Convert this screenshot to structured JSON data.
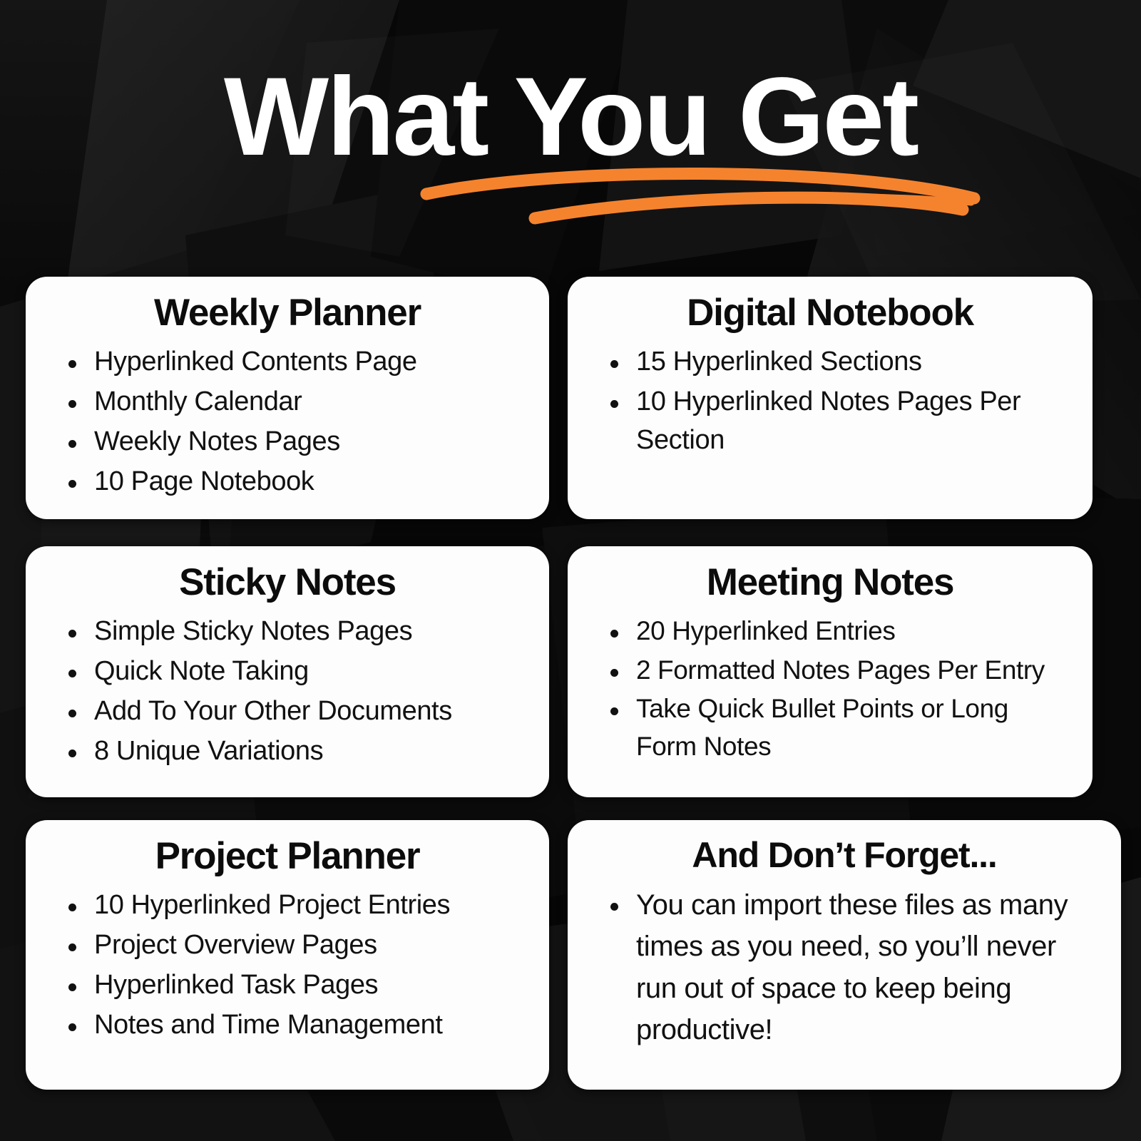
{
  "header": {
    "title": "What You Get",
    "accent_color": "#F5832E",
    "background_color": "#0b0b0b",
    "title_color": "#ffffff",
    "underline_icon": "swoosh-underline-icon"
  },
  "card_style": {
    "background": "#fdfdfd",
    "text_color": "#111111",
    "bullet_icon": "bullet-dot-icon"
  },
  "cards": [
    {
      "id": "weekly-planner",
      "title": "Weekly Planner",
      "bullets": [
        "Hyperlinked Contents Page",
        "Monthly Calendar",
        "Weekly Notes Pages",
        "10 Page Notebook"
      ]
    },
    {
      "id": "digital-notebook",
      "title": "Digital Notebook",
      "bullets": [
        "15 Hyperlinked Sections",
        "10 Hyperlinked Notes Pages Per Section"
      ]
    },
    {
      "id": "sticky-notes",
      "title": "Sticky Notes",
      "bullets": [
        "Simple Sticky Notes Pages",
        "Quick Note Taking",
        "Add To Your Other Documents",
        "8 Unique Variations"
      ]
    },
    {
      "id": "meeting-notes",
      "title": "Meeting Notes",
      "bullets": [
        "20 Hyperlinked Entries",
        "2 Formatted Notes Pages Per Entry",
        "Take Quick Bullet Points or Long Form Notes"
      ]
    },
    {
      "id": "project-planner",
      "title": "Project Planner",
      "bullets": [
        "10 Hyperlinked Project Entries",
        "Project Overview Pages",
        "Hyperlinked Task Pages",
        "Notes and Time Management"
      ]
    },
    {
      "id": "dont-forget",
      "title": "And Don’t Forget...",
      "bullets": [
        "You can import these files as many times as you need, so you’ll never run out of space to keep being productive!"
      ]
    }
  ]
}
